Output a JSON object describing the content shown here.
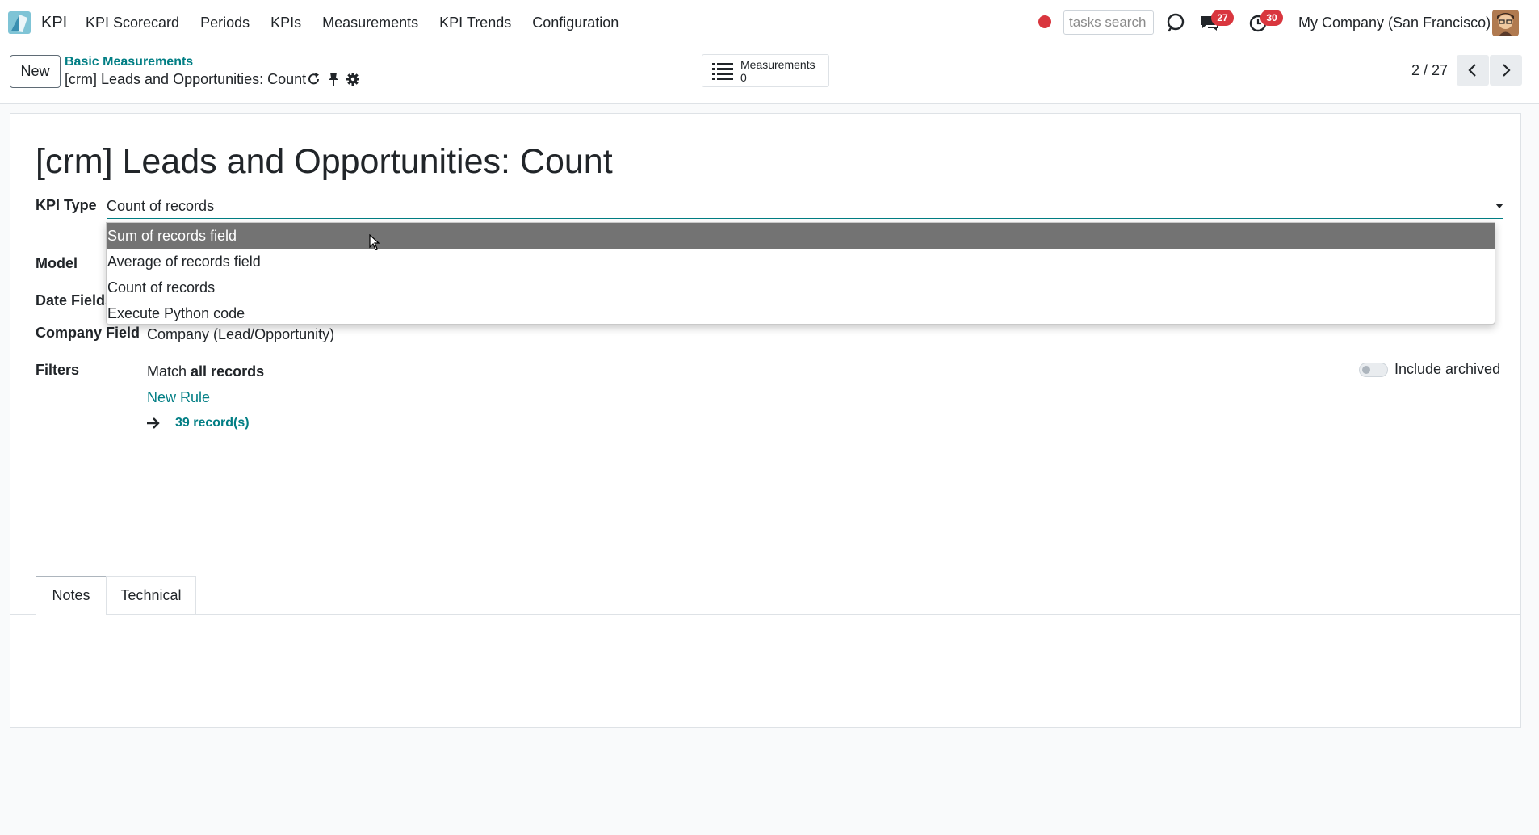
{
  "app": {
    "name": "KPI"
  },
  "menu": [
    "KPI Scorecard",
    "Periods",
    "KPIs",
    "Measurements",
    "KPI Trends",
    "Configuration"
  ],
  "search": {
    "placeholder": "tasks search"
  },
  "badges": {
    "messages": "27",
    "activities": "30"
  },
  "company": "My Company (San Francisco)",
  "control": {
    "new_label": "New",
    "breadcrumb_parent": "Basic Measurements",
    "record_name": "[crm] Leads and Opportunities: Count",
    "smart_button": {
      "label": "Measurements",
      "value": "0"
    },
    "pager": "2 / 27"
  },
  "form": {
    "title": "[crm] Leads and Opportunities: Count",
    "labels": {
      "kpi_type": "KPI Type",
      "model": "Model",
      "date_fields": "Date Fields",
      "company_field": "Company Field",
      "filters": "Filters"
    },
    "kpi_type_value": "Count of records",
    "company_field_value": "Company (Lead/Opportunity)",
    "filters": {
      "match_prefix": "Match",
      "match_bold": "all records",
      "new_rule": "New Rule",
      "records": "39 record(s)",
      "include_archived": "Include archived"
    },
    "tabs": [
      "Notes",
      "Technical"
    ]
  },
  "dropdown": {
    "options": [
      "Sum of records field",
      "Average of records field",
      "Count of records",
      "Execute Python code"
    ],
    "highlighted": "Sum of records field"
  },
  "colors": {
    "accent": "#017e84",
    "badge": "#d9363e",
    "highlight": "#737373"
  }
}
